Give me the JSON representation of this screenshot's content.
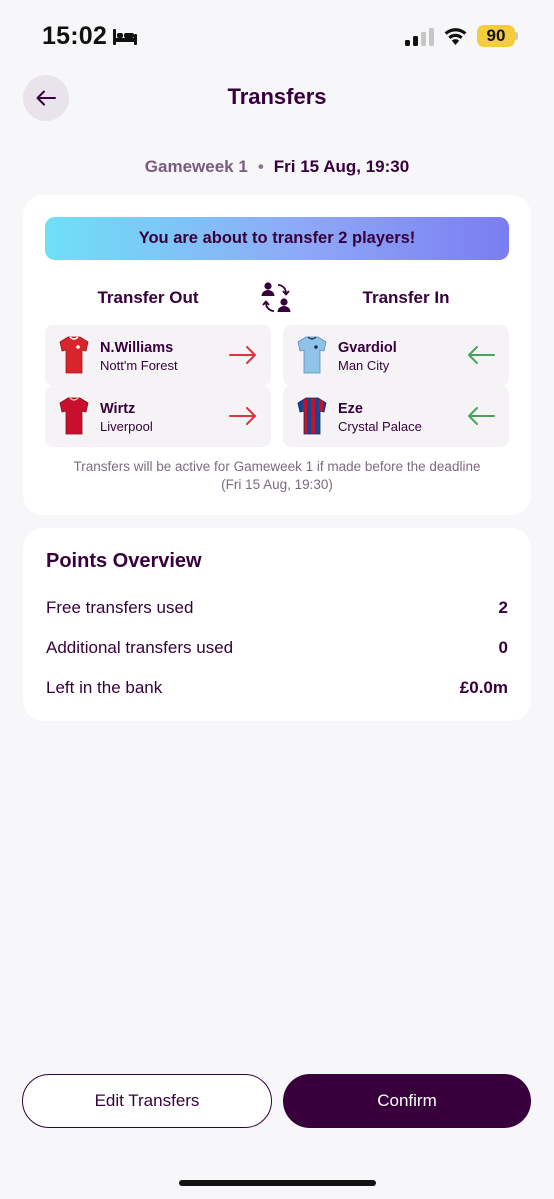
{
  "status_bar": {
    "time": "15:02",
    "battery": "90"
  },
  "header": {
    "title": "Transfers",
    "gameweek": "Gameweek 1",
    "separator": "•",
    "deadline": "Fri 15 Aug, 19:30"
  },
  "transfer_card": {
    "banner": "You are about to transfer 2 players!",
    "out_heading": "Transfer Out",
    "in_heading": "Transfer In",
    "transfers_out": [
      {
        "name": "N.Williams",
        "club": "Nott'm Forest",
        "shirt": "nottm-forest-shirt-icon"
      },
      {
        "name": "Wirtz",
        "club": "Liverpool",
        "shirt": "liverpool-shirt-icon"
      }
    ],
    "transfers_in": [
      {
        "name": "Gvardiol",
        "club": "Man City",
        "shirt": "man-city-shirt-icon"
      },
      {
        "name": "Eze",
        "club": "Crystal Palace",
        "shirt": "crystal-palace-shirt-icon"
      }
    ],
    "note_line1": "Transfers will be active for Gameweek 1 if made before the deadline",
    "note_line2": "(Fri 15 Aug, 19:30)",
    "colors": {
      "out_arrow": "#d9373c",
      "in_arrow": "#4aa356"
    }
  },
  "points_overview": {
    "title": "Points Overview",
    "rows": [
      {
        "label": "Free transfers used",
        "value": "2"
      },
      {
        "label": "Additional transfers used",
        "value": "0"
      },
      {
        "label": "Left in the bank",
        "value": "£0.0m"
      }
    ]
  },
  "buttons": {
    "edit": "Edit Transfers",
    "confirm": "Confirm"
  },
  "colors": {
    "brand": "#37003c",
    "battery": "#f5cc3c"
  }
}
